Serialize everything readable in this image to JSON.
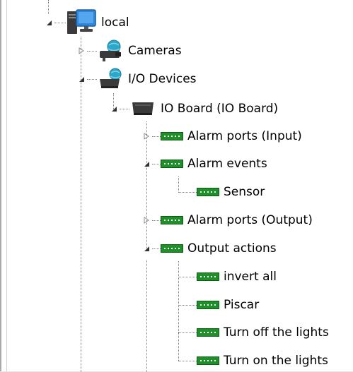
{
  "tree": {
    "root": {
      "label": "local",
      "icon": "computer-icon",
      "expanded": true,
      "children": {
        "cameras": {
          "label": "Cameras",
          "icon": "camera-group-icon",
          "expanded": false
        },
        "io_devices": {
          "label": "I/O Devices",
          "icon": "io-devices-icon",
          "expanded": true,
          "board": {
            "label": "IO Board (IO Board)",
            "icon": "io-board-icon",
            "expanded": true,
            "alarm_ports_input": {
              "label": "Alarm ports (Input)",
              "icon": "port-icon",
              "expanded": false
            },
            "alarm_events": {
              "label": "Alarm events",
              "icon": "port-icon",
              "expanded": true,
              "items": [
                {
                  "label": "Sensor",
                  "icon": "port-icon"
                }
              ]
            },
            "alarm_ports_output": {
              "label": "Alarm ports (Output)",
              "icon": "port-icon",
              "expanded": false
            },
            "output_actions": {
              "label": "Output actions",
              "icon": "port-icon",
              "expanded": true,
              "items": [
                {
                  "label": "invert all",
                  "icon": "port-icon"
                },
                {
                  "label": "Piscar",
                  "icon": "port-icon"
                },
                {
                  "label": "Turn off the lights",
                  "icon": "port-icon"
                },
                {
                  "label": "Turn on the lights",
                  "icon": "port-icon"
                }
              ]
            }
          }
        }
      }
    }
  },
  "colors": {
    "port_green": "#1f8f2a",
    "port_green_dark": "#0f5c17",
    "port_dots": "#ffffff",
    "monitor_blue": "#2f86d8",
    "device_dark": "#3a3a3a",
    "camera_globe": "#2aa7c9",
    "tree_lines": "#7a7a7a"
  }
}
